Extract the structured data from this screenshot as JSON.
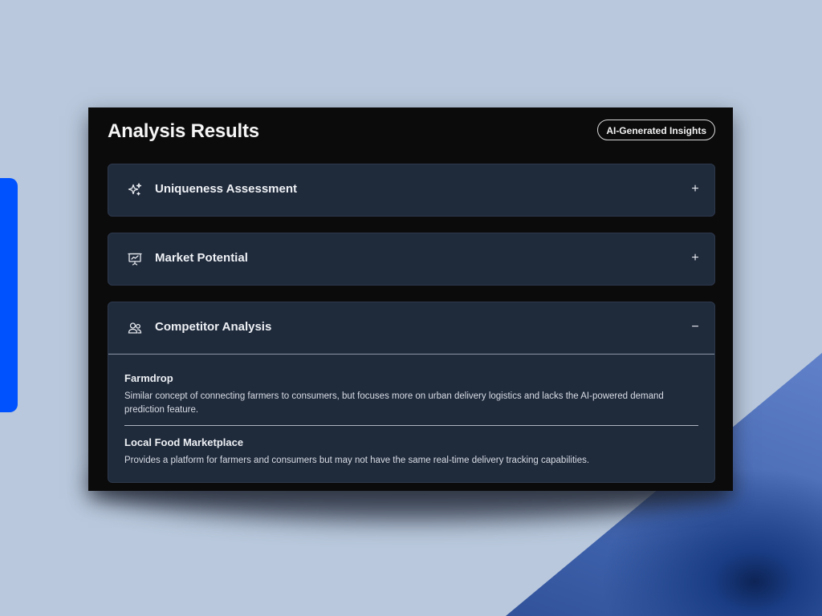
{
  "panel": {
    "title": "Analysis Results",
    "badge": "AI-Generated Insights"
  },
  "sections": [
    {
      "title": "Uniqueness Assessment",
      "icon": "sparkles-icon",
      "toggle": "+",
      "expanded": false
    },
    {
      "title": "Market Potential",
      "icon": "presentation-chart-icon",
      "toggle": "+",
      "expanded": false
    },
    {
      "title": "Competitor Analysis",
      "icon": "users-icon",
      "toggle": "−",
      "expanded": true,
      "competitors": [
        {
          "name": "Farmdrop",
          "description": "Similar concept of connecting farmers to consumers, but focuses more on urban delivery logistics and lacks the AI-powered demand prediction feature."
        },
        {
          "name": "Local Food Marketplace",
          "description": "Provides a platform for farmers and consumers but may not have the same real-time delivery tracking capabilities."
        }
      ]
    }
  ],
  "colors": {
    "accent_bar": "#0052ff",
    "panel_bg": "#0b0b0c",
    "card_bg": "#1f2a3b",
    "page_bg": "#b9c8dc"
  }
}
